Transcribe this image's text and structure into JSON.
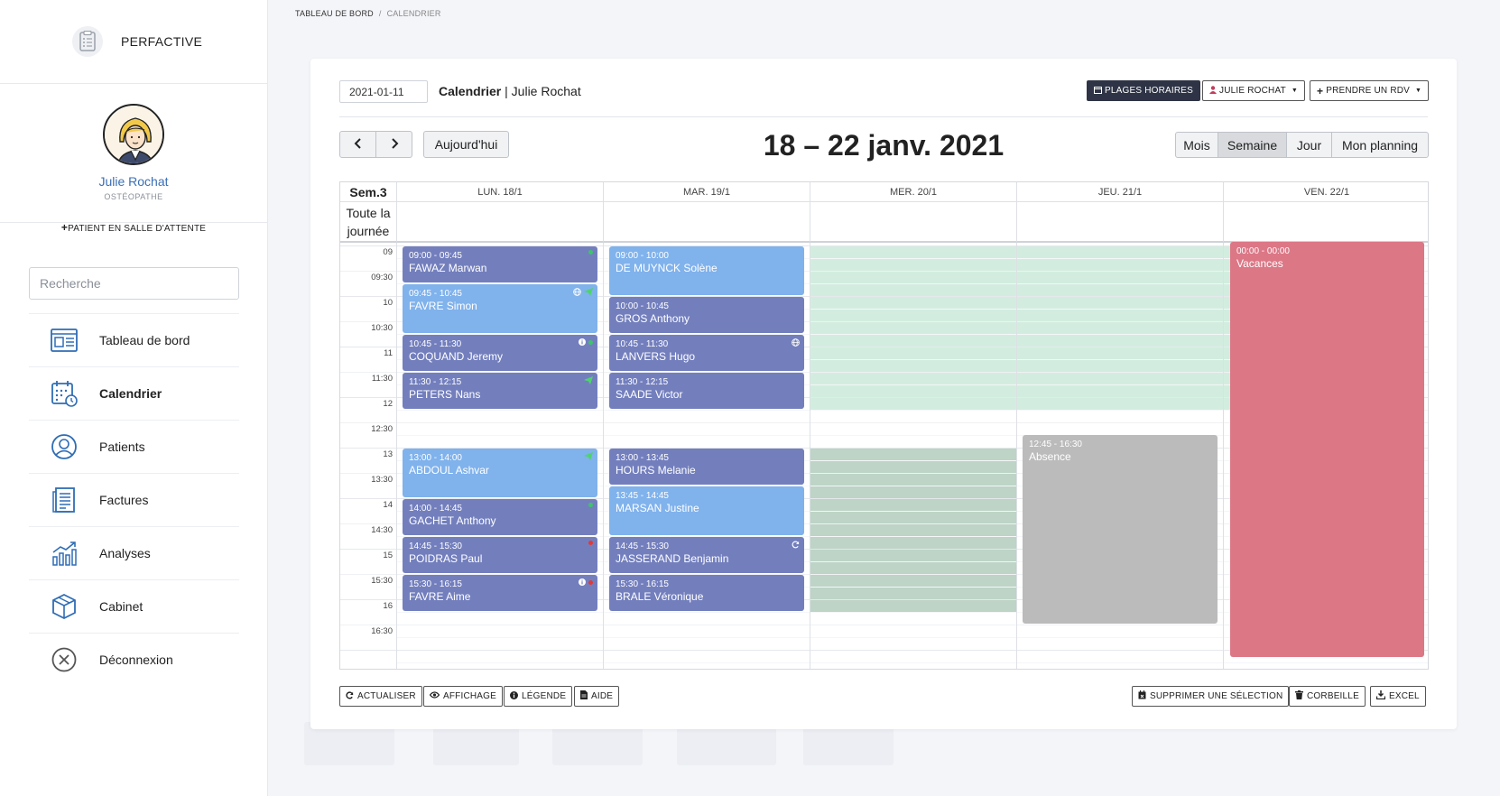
{
  "brand": {
    "name": "PERFACTIVE",
    "logo_icon": "clipboard-list-icon"
  },
  "profile": {
    "name": "Julie Rochat",
    "role": "OSTÉOPATHE"
  },
  "waiting_room": {
    "label": "PATIENT EN SALLE D'ATTENTE"
  },
  "search": {
    "placeholder": "Recherche"
  },
  "nav": [
    {
      "label": "Tableau de bord",
      "icon": "dashboard-icon",
      "active": false
    },
    {
      "label": "Calendrier",
      "icon": "calendar-icon",
      "active": true
    },
    {
      "label": "Patients",
      "icon": "user-icon",
      "active": false
    },
    {
      "label": "Factures",
      "icon": "invoice-icon",
      "active": false
    },
    {
      "label": "Analyses",
      "icon": "chart-icon",
      "active": false
    },
    {
      "label": "Cabinet",
      "icon": "box-icon",
      "active": false
    },
    {
      "label": "Déconnexion",
      "icon": "close-circle-icon",
      "active": false
    }
  ],
  "breadcrumb": {
    "home": "TABLEAU DE BORD",
    "separator": "/",
    "current": "CALENDRIER"
  },
  "toolbar": {
    "date_value": "2021-01-11",
    "title_bold": "Calendrier",
    "title_rest": " | Julie Rochat",
    "plages": "PLAGES HORAIRES",
    "practitioner": "JULIE ROCHAT",
    "new_rdv": "PRENDRE UN RDV"
  },
  "calendar": {
    "today": "Aujourd'hui",
    "range": "18 – 22 janv. 2021",
    "views": [
      "Mois",
      "Semaine",
      "Jour",
      "Mon planning"
    ],
    "active_view": "Semaine",
    "week_label": "Sem.3",
    "allday_label": "Toute la journée",
    "days": [
      "LUN. 18/1",
      "MAR. 19/1",
      "MER. 20/1",
      "JEU. 21/1",
      "VEN. 22/1"
    ],
    "time_labels": [
      "09",
      "09:30",
      "10",
      "10:30",
      "11",
      "11:30",
      "12",
      "12:30",
      "13",
      "13:30",
      "14",
      "14:30",
      "15",
      "15:30",
      "16",
      "16:30"
    ],
    "colors": {
      "dark_event": "#737fbd",
      "light_event": "#80b2ec",
      "available": "#cdebdc",
      "available_pm": "#bdd4c6",
      "absence": "#bbbbbb",
      "vacation": "#dc7786"
    },
    "events": [
      {
        "day": 0,
        "start": "09:00",
        "end": "09:45",
        "time": "09:00 - 09:45",
        "name": "FAWAZ Marwan",
        "tone": "dark",
        "icons": [
          "green-dot"
        ]
      },
      {
        "day": 0,
        "start": "09:45",
        "end": "10:45",
        "time": "09:45 - 10:45",
        "name": "FAVRE Simon",
        "tone": "light",
        "icons": [
          "globe",
          "send"
        ]
      },
      {
        "day": 0,
        "start": "10:45",
        "end": "11:30",
        "time": "10:45 - 11:30",
        "name": "COQUAND Jeremy",
        "tone": "dark",
        "icons": [
          "info",
          "green-dot"
        ]
      },
      {
        "day": 0,
        "start": "11:30",
        "end": "12:15",
        "time": "11:30 - 12:15",
        "name": "PETERS Nans",
        "tone": "dark",
        "icons": [
          "send"
        ]
      },
      {
        "day": 0,
        "start": "13:00",
        "end": "14:00",
        "time": "13:00 - 14:00",
        "name": "ABDOUL Ashvar",
        "tone": "light",
        "icons": [
          "send"
        ]
      },
      {
        "day": 0,
        "start": "14:00",
        "end": "14:45",
        "time": "14:00 - 14:45",
        "name": "GACHET Anthony",
        "tone": "dark",
        "icons": [
          "green-dot"
        ]
      },
      {
        "day": 0,
        "start": "14:45",
        "end": "15:30",
        "time": "14:45 - 15:30",
        "name": "POIDRAS Paul",
        "tone": "dark",
        "icons": [
          "red-dot"
        ]
      },
      {
        "day": 0,
        "start": "15:30",
        "end": "16:15",
        "time": "15:30 - 16:15",
        "name": "FAVRE Aime",
        "tone": "dark",
        "icons": [
          "info",
          "red-dot"
        ]
      },
      {
        "day": 1,
        "start": "09:00",
        "end": "10:00",
        "time": "09:00 - 10:00",
        "name": "DE MUYNCK Solène",
        "tone": "light",
        "icons": []
      },
      {
        "day": 1,
        "start": "10:00",
        "end": "10:45",
        "time": "10:00 - 10:45",
        "name": "GROS Anthony",
        "tone": "dark",
        "icons": []
      },
      {
        "day": 1,
        "start": "10:45",
        "end": "11:30",
        "time": "10:45 - 11:30",
        "name": "LANVERS Hugo",
        "tone": "dark",
        "icons": [
          "globe"
        ]
      },
      {
        "day": 1,
        "start": "11:30",
        "end": "12:15",
        "time": "11:30 - 12:15",
        "name": "SAADE Victor",
        "tone": "dark",
        "icons": []
      },
      {
        "day": 1,
        "start": "13:00",
        "end": "13:45",
        "time": "13:00 - 13:45",
        "name": "HOURS Melanie",
        "tone": "dark",
        "icons": []
      },
      {
        "day": 1,
        "start": "13:45",
        "end": "14:45",
        "time": "13:45 - 14:45",
        "name": "MARSAN Justine",
        "tone": "light",
        "icons": []
      },
      {
        "day": 1,
        "start": "14:45",
        "end": "15:30",
        "time": "14:45 - 15:30",
        "name": "JASSERAND Benjamin",
        "tone": "dark",
        "icons": [
          "refresh"
        ]
      },
      {
        "day": 1,
        "start": "15:30",
        "end": "16:15",
        "time": "15:30 - 16:15",
        "name": "BRALE Véronique",
        "tone": "dark",
        "icons": []
      }
    ],
    "absence": {
      "day": 3,
      "start": "12:45",
      "end": "16:30",
      "time": "12:45 - 16:30",
      "name": "Absence"
    },
    "vacation": {
      "day": 4,
      "time": "00:00 - 00:00",
      "name": "Vacances"
    }
  },
  "bottom": {
    "refresh": "ACTUALISER",
    "display": "AFFICHAGE",
    "legend": "LÉGENDE",
    "help": "AIDE",
    "delete_selection": "SUPPRIMER UNE SÉLECTION",
    "trash": "CORBEILLE",
    "excel": "EXCEL"
  }
}
